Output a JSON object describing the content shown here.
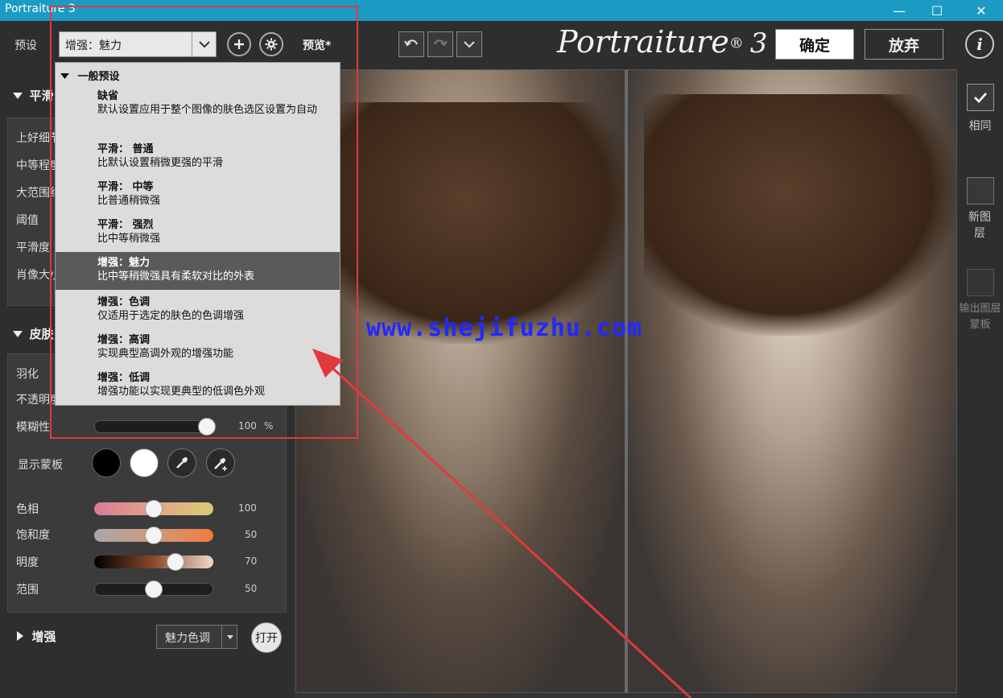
{
  "window": {
    "title": "Portraiture 3",
    "minimize": "—",
    "maximize": "☐",
    "close": "✕"
  },
  "toolbar": {
    "preset_label": "预设",
    "preset_value": "增强：魅力",
    "preview_label": "预览*",
    "logo": "Portraiture",
    "logo_reg": "®",
    "logo_ver": "3",
    "ok_label": "确定",
    "cancel_label": "放弃",
    "info": "i"
  },
  "left": {
    "smooth_header": "平滑",
    "smooth_labels": [
      "上好细节",
      "中等程度",
      "大范围细节",
      "阈值",
      "平滑度",
      "肖像大小"
    ],
    "skin_header": "皮肤",
    "skin_labels": [
      "羽化",
      "不透明度"
    ],
    "blur_label": "模糊性",
    "blur_value": "100",
    "blur_unit": "%",
    "mask_label": "显示蒙板",
    "hue": {
      "label": "色相",
      "value": "100",
      "level": 0.5
    },
    "saturation": {
      "label": "饱和度",
      "value": "50",
      "level": 0.5
    },
    "brightness": {
      "label": "明度",
      "value": "70",
      "level": 0.68
    },
    "range": {
      "label": "范围",
      "value": "50",
      "level": 0.5
    },
    "enhance_header": "增强",
    "enhance_select": "魅力色调",
    "enhance_toggle": "打开"
  },
  "right": {
    "same": "相同",
    "new_layer": "新图层",
    "output_mask": "输出图层蒙板"
  },
  "dropdown": {
    "group": "一般预设",
    "items": [
      {
        "title": "缺省",
        "desc": "默认设置应用于整个图像的肤色选区设置为自动"
      },
      {
        "title": "平滑： 普通",
        "desc": "比默认设置稍微更强的平滑"
      },
      {
        "title": "平滑： 中等",
        "desc": "比普通稍微强"
      },
      {
        "title": "平滑： 强烈",
        "desc": "比中等稍微强"
      },
      {
        "title": "增强：魅力",
        "desc": "比中等稍微强具有柔软对比的外表"
      },
      {
        "title": "增强：色调",
        "desc": "仅适用于选定的肤色的色调增强"
      },
      {
        "title": "增强：高调",
        "desc": "实现典型高调外观的增强功能"
      },
      {
        "title": "增强：低调",
        "desc": "增强功能以实现更典型的低调色外观"
      }
    ]
  },
  "watermark": "www.shejifuzhu.com",
  "colors": {
    "titlebar": "#1b9bc4",
    "annotation": "#e03a3a",
    "watermark": "#2228ff"
  }
}
